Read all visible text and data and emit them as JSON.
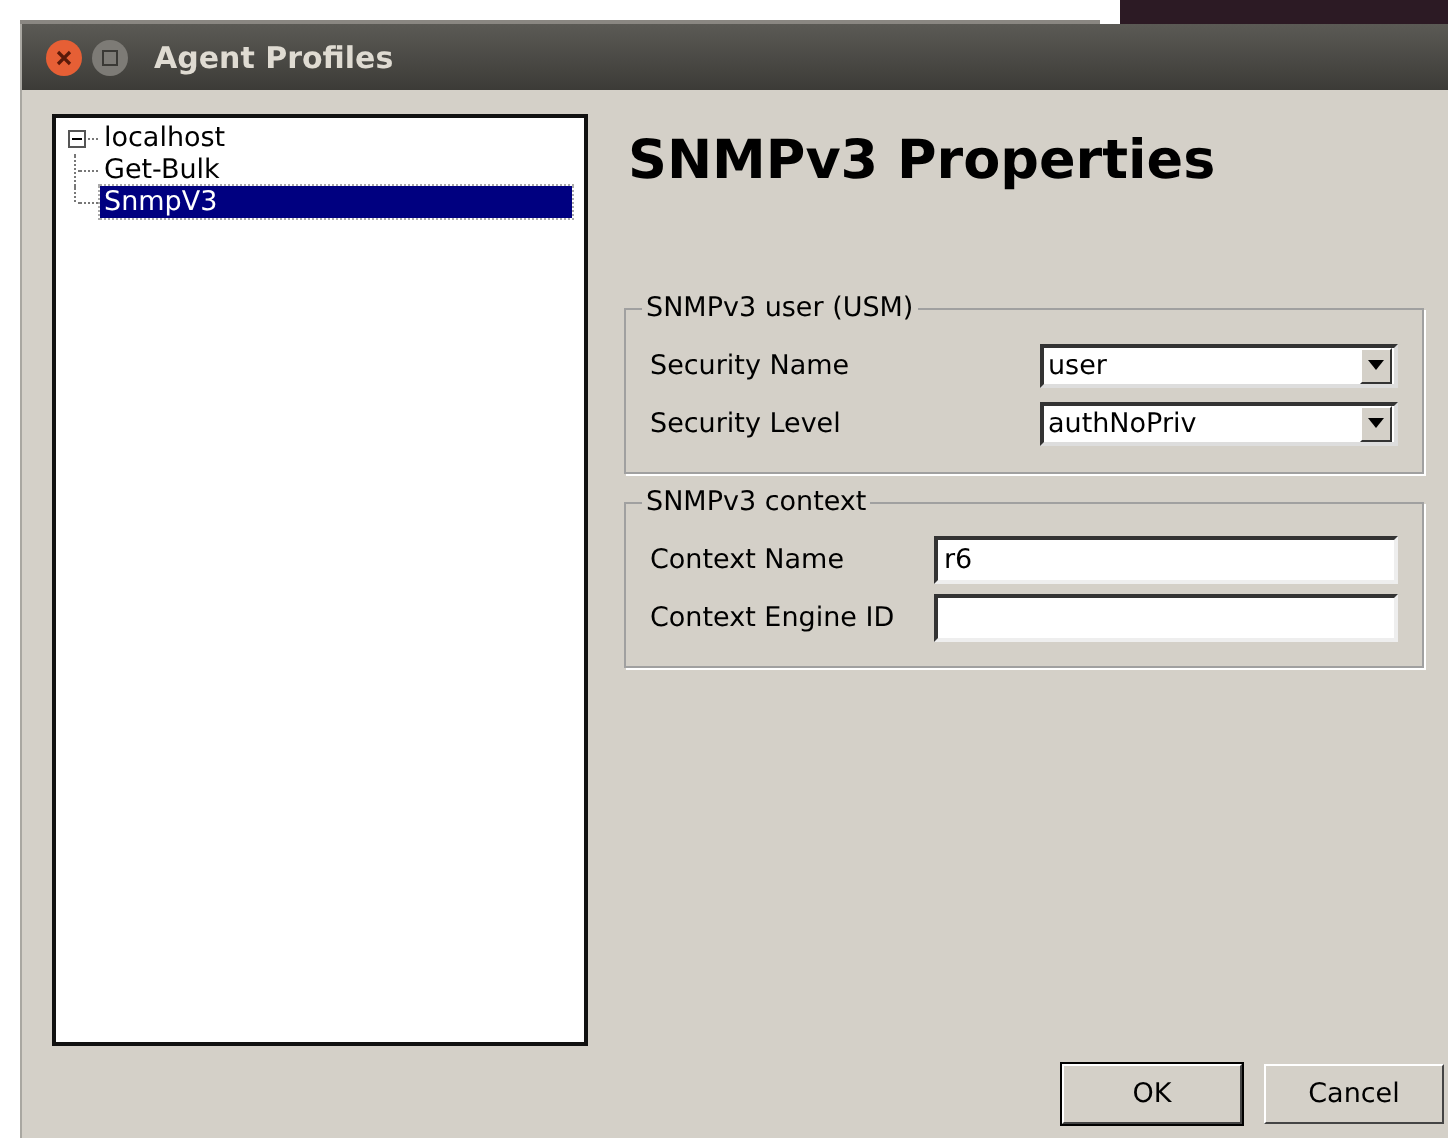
{
  "window": {
    "title": "Agent Profiles"
  },
  "tree": [
    {
      "label": "localhost",
      "expanded": true,
      "selected": false,
      "children": [
        {
          "label": "Get-Bulk",
          "selected": false
        },
        {
          "label": "SnmpV3",
          "selected": true
        }
      ]
    }
  ],
  "heading": "SNMPv3 Properties",
  "groups": [
    {
      "title": "SNMPv3 user (USM)",
      "fields": [
        {
          "kind": "dropdown",
          "label": "Security Name",
          "value": "user"
        },
        {
          "kind": "dropdown",
          "label": "Security Level",
          "value": "authNoPriv"
        }
      ]
    },
    {
      "title": "SNMPv3 context",
      "fields": [
        {
          "kind": "text",
          "label": "Context Name",
          "value": "r6"
        },
        {
          "kind": "text",
          "label": "Context Engine ID"
        }
      ]
    }
  ],
  "buttons": [
    {
      "label": "OK",
      "default": true
    },
    {
      "label": "Cancel",
      "default": false
    }
  ]
}
